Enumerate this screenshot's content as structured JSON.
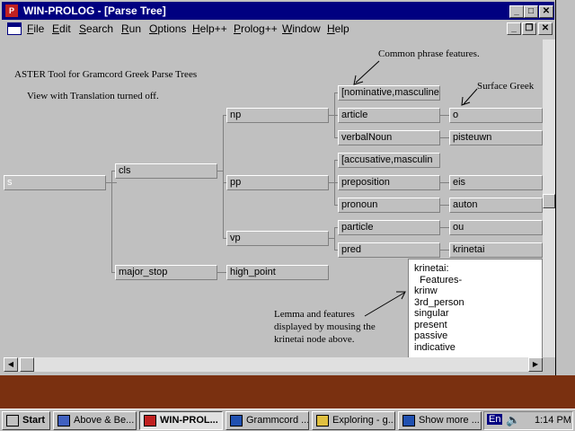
{
  "window": {
    "title": "WIN-PROLOG - [Parse Tree]",
    "app_icon": "prolog-icon",
    "minimize": "_",
    "maximize": "□",
    "close": "✕"
  },
  "menu": {
    "items": [
      "File",
      "Edit",
      "Search",
      "Run",
      "Options",
      "Help++",
      "Prolog++",
      "Window",
      "Help"
    ],
    "child_minimize": "_",
    "child_restore": "❐",
    "child_close": "✕"
  },
  "content": {
    "heading": "ASTER Tool for Gramcord Greek Parse Trees",
    "subheading": "View with Translation turned off.",
    "annotation_phrase": "Common phrase features.",
    "annotation_surface": "Surface Greek",
    "annotation_lemma_1": "Lemma and features",
    "annotation_lemma_2": "displayed by mousing the",
    "annotation_lemma_3": "krinetai node above."
  },
  "tree": {
    "root": "s",
    "cls": "cls",
    "np": "np",
    "pp": "pp",
    "vp": "vp",
    "major_stop": "major_stop",
    "high_point": "high_point",
    "np_features": "[nominative,masculine",
    "article": "article",
    "verbalNoun": "verbalNoun",
    "pp_features": "[accusative,masculin",
    "preposition": "preposition",
    "pronoun": "pronoun",
    "particle": "particle",
    "pred": "pred",
    "w_article": "o",
    "w_verbalNoun": "pisteuwn",
    "w_preposition": "eis",
    "w_pronoun": "auton",
    "w_particle": "ou",
    "w_pred": "krinetai"
  },
  "popup": {
    "lines": [
      "krinetai:",
      "  Features-",
      "krinw",
      "3rd_person",
      "singular",
      "present",
      "passive",
      "indicative"
    ]
  },
  "taskbar": {
    "start": "Start",
    "tasks": [
      "Above & Be...",
      "WIN-PROL...",
      "Grammcord ...",
      "Exploring - g...",
      "Show more ..."
    ],
    "language": "En",
    "clock": "1:14 PM"
  }
}
